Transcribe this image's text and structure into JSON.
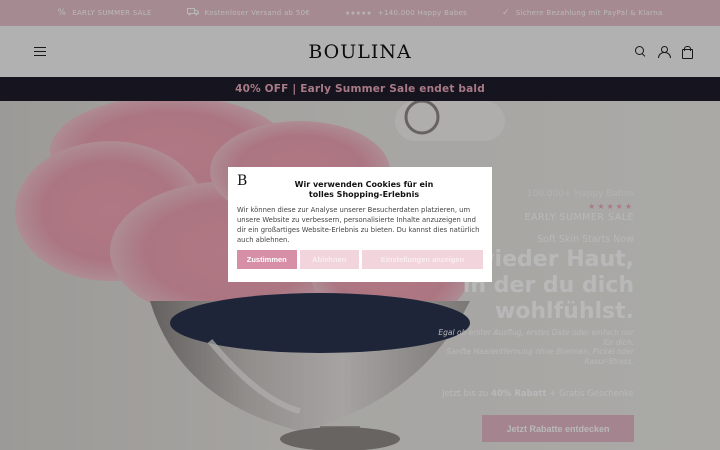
{
  "topbar": {
    "items": [
      {
        "icon": "percent-icon",
        "text": "EARLY SUMMER SALE"
      },
      {
        "icon": "truck-icon",
        "text": "Kostenloser Versand ab 50€"
      },
      {
        "icon": "stars-icon",
        "stars": "★★★★★",
        "text": "+140.000 Happy Babes"
      },
      {
        "icon": "check-icon",
        "text": "Sichere Bezahlung mit PayPal & Klarna"
      }
    ]
  },
  "header": {
    "logo": "BOULINA"
  },
  "salebar": {
    "text": "40% OFF | Early Summer Sale endet bald"
  },
  "hero": {
    "happy": "100.000+ Happy Babes",
    "stars": "★★★★★",
    "sale_label": "EARLY SUMMER SALE",
    "tagline": "Soft Skin Starts Now",
    "headline_1": "wieder Haut,",
    "headline_2": "in der du dich",
    "headline_3": "wohlfühlst.",
    "desc_1": "Egal ob erster Ausflug, erstes Date oder einfach nur",
    "desc_2": "für dich.",
    "desc_3": "Sanfte Haarentfernung ohne Brennen, Pickel oder",
    "desc_4": "Rasur-Stress.",
    "offer_prefix": "Jetzt bis zu",
    "offer_bold": "40% Rabatt",
    "offer_suffix": "+ Gratis Geschenke",
    "cta": "Jetzt Rabatte entdecken"
  },
  "cookie": {
    "logo": "B",
    "title_1": "Wir verwenden Cookies für ein",
    "title_2": "tolles Shopping-Erlebnis",
    "body": "Wir können diese zur Analyse unserer Besucherdaten platzieren, um unsere Website zu verbessern, personalisierte Inhalte anzuzeigen und dir ein großartiges Website-Erlebnis zu bieten. Du kannst dies natürlich auch ablehnen.",
    "accept": "Zustimmen",
    "reject": "Ablehnen",
    "settings": "Einstellungen anzeigen"
  },
  "colors": {
    "topbar": "#e7bfc9",
    "salebar_bg": "#1f1c2c",
    "salebar_text": "#e8a9b9",
    "accent": "#d68fa6"
  }
}
